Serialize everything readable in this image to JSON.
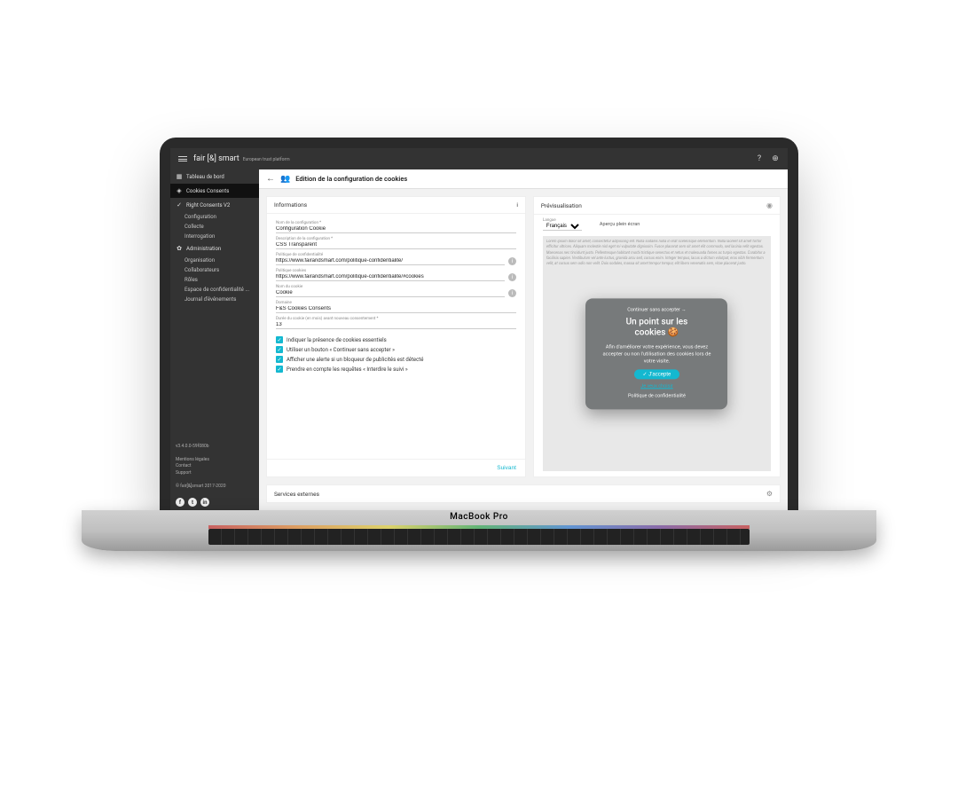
{
  "brand": {
    "name": "fair [&] smart",
    "subtitle": "European trust platform"
  },
  "topbar": {
    "help_icon": "?",
    "globe_icon": "⊕"
  },
  "sidebar": {
    "items": [
      {
        "icon": "▦",
        "label": "Tableau de bord"
      },
      {
        "icon": "◈",
        "label": "Cookies Consents"
      },
      {
        "icon": "✓",
        "label": "Right Consents V2"
      }
    ],
    "rc_sub": [
      "Configuration",
      "Collecte",
      "Interrogation"
    ],
    "admin": {
      "icon": "✿",
      "label": "Administration"
    },
    "admin_sub": [
      "Organisation",
      "Collaborateurs",
      "Rôles",
      "Espace de confidentialité ...",
      "Journal d'événements"
    ],
    "version": "v3.4.0.0-59f080b",
    "footer_links": [
      "Mentions légales",
      "Contact",
      "Support"
    ],
    "copyright": "© fair[&]smart 2017-2020"
  },
  "page": {
    "title": "Edition de la configuration de cookies"
  },
  "info_panel": {
    "title": "Informations",
    "fields": {
      "name": {
        "label": "Nom de la configuration *",
        "value": "Configuration Cookie"
      },
      "desc": {
        "label": "Description de la configuration *",
        "value": "CSS Transparent"
      },
      "policy": {
        "label": "Politique de confidentialité",
        "value": "https://www.fairandsmart.com/politique-confidentialite/",
        "has_info": true
      },
      "cookie_policy": {
        "label": "Politique cookies",
        "value": "https://www.fairandsmart.com/politique-confidentialite/#cookies",
        "has_info": true
      },
      "cookie_name": {
        "label": "Nom du cookie",
        "value": "Cookie",
        "has_info": true
      },
      "domain": {
        "label": "Domaine",
        "value": "F&S Cookies Consents"
      },
      "duration": {
        "label": "Durée du cookie (en mois) avant nouveau consentement *",
        "value": "13"
      }
    },
    "checks": [
      "Indiquer la présence de cookies essentiels",
      "Utiliser un bouton « Continuer sans accepter »",
      "Afficher une alerte si un bloqueur de publicités est détecté",
      "Prendre en compte les requêtes « Interdire le suivi »"
    ],
    "next": "Suivant"
  },
  "services": {
    "title": "Services externes"
  },
  "preview_panel": {
    "title": "Prévisualisation",
    "lang_label": "Langue",
    "lang_value": "Français",
    "fullscreen": "Aperçu plein écran",
    "lorem": "Lorem ipsum dolor sit amet, consectetur adipiscing elit. Nulla sodales nulla in erat scelerisque elementum. Nulla laoreet sit amet tortor efficitur ultrices. Aliquam molestie nisl eget mi vulputate dignissim. Fusce placerat sem sit amet elit commodo, sed lacinia velit egestas. Maecenas nec tincidunt justo. Pellentesque habitant morbi tristique senectus et netus et malesuada fames ac turpis egestas. Curabitur a facilisis sapien. Vestibulum vel ante luctus, gravida arcu sed, cursus enim. Integer tempus, lacus a dictum volutpat, eros nibh fermentum velit, at cursus sem odio non velit. Duis sodales, massa sit amet tempor tempor, elit libero venenatis sem, vitae placerat justo."
  },
  "cookie_modal": {
    "skip": "Continuer sans accepter →",
    "title_l1": "Un point sur les",
    "title_l2": "cookies",
    "emoji": "🍪",
    "desc": "Afin d'améliorer votre expérience, vous devez accepter ou non l'utilisation des cookies lors de votre visite.",
    "accept": "✓ J'accepte",
    "custom": "Je veux choisir",
    "policy": "Politique de confidentialité"
  },
  "device": {
    "label": "MacBook Pro"
  }
}
